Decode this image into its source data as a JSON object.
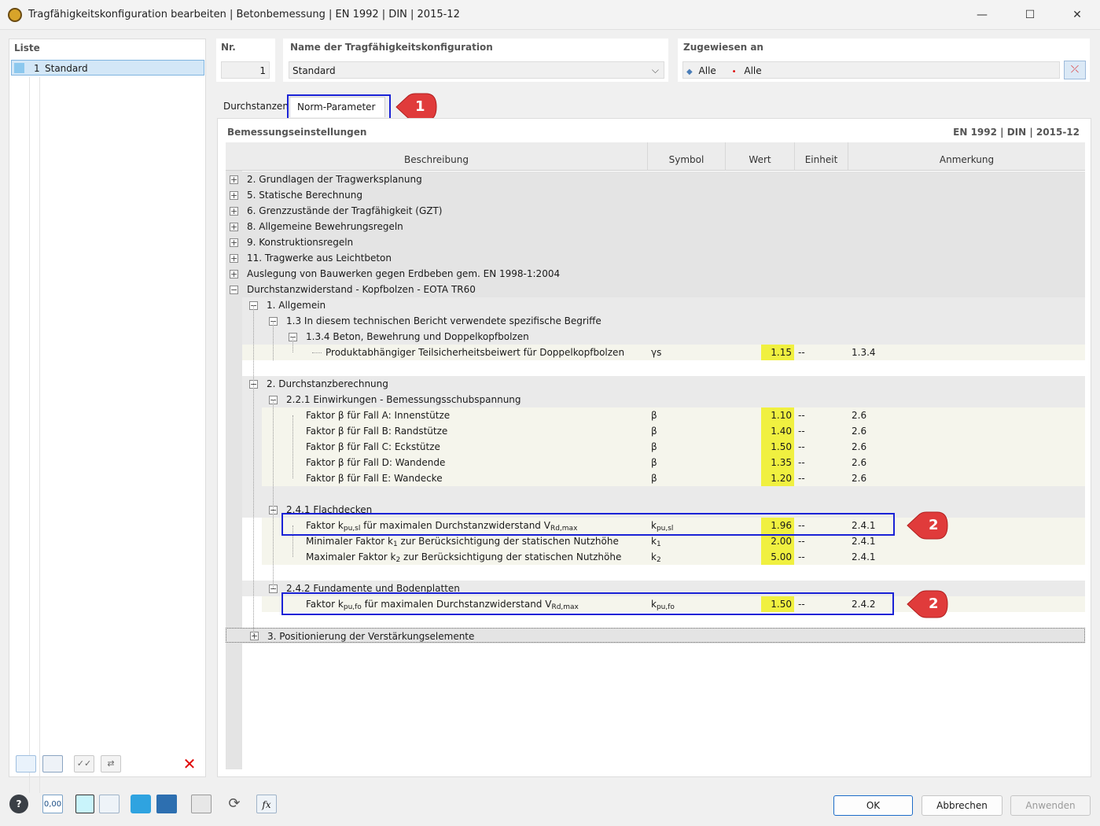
{
  "window": {
    "title": "Tragfähigkeitskonfiguration bearbeiten | Betonbemessung | EN 1992 | DIN | 2015-12",
    "minimize": "—",
    "maximize": "☐",
    "close": "✕"
  },
  "list": {
    "heading": "Liste",
    "items": [
      {
        "num": "1",
        "label": "Standard"
      }
    ]
  },
  "fields": {
    "nr_label": "Nr.",
    "nr_value": "1",
    "name_label": "Name der Tragfähigkeitskonfiguration",
    "name_value": "Standard",
    "assigned_label": "Zugewiesen an",
    "assigned_a": "Alle",
    "assigned_b": "Alle"
  },
  "tabs": [
    "Durchstanzen",
    "Norm-Parameter"
  ],
  "section": {
    "title": "Bemessungseinstellungen",
    "norm": "EN 1992 | DIN | 2015-12"
  },
  "columns": [
    "Beschreibung",
    "Symbol",
    "Wert",
    "Einheit",
    "Anmerkung"
  ],
  "rows": {
    "r1": "2. Grundlagen der Tragwerksplanung",
    "r2": "5. Statische Berechnung",
    "r3": "6. Grenzzustände der Tragfähigkeit (GZT)",
    "r4": "8. Allgemeine Bewehrungsregeln",
    "r5": "9. Konstruktionsregeln",
    "r6": "11. Tragwerke aus Leichtbeton",
    "r7": "Auslegung von Bauwerken gegen Erdbeben gem. EN 1998-1:2004",
    "r8": "Durchstanzwiderstand - Kopfbolzen - EOTA TR60",
    "r9": "1. Allgemein",
    "r10": "1.3 In diesem technischen Bericht verwendete spezifische Begriffe",
    "r11": "1.3.4 Beton, Bewehrung und Doppelkopfbolzen",
    "r12": "Produktabhängiger Teilsicherheitsbeiwert für Doppelkopfbolzen",
    "r12_sym": "γs",
    "r12_val": "1.15",
    "r12_unit": "--",
    "r12_note": "1.3.4",
    "r13": "2. Durchstanzberechnung",
    "r14": "2.2.1 Einwirkungen - Bemessungsschubspannung",
    "beta": [
      {
        "label": "Faktor β für Fall A: Innenstütze",
        "sym": "β",
        "val": "1.10",
        "unit": "--",
        "note": "2.6"
      },
      {
        "label": "Faktor β für Fall B: Randstütze",
        "sym": "β",
        "val": "1.40",
        "unit": "--",
        "note": "2.6"
      },
      {
        "label": "Faktor β für Fall C: Eckstütze",
        "sym": "β",
        "val": "1.50",
        "unit": "--",
        "note": "2.6"
      },
      {
        "label": "Faktor β für Fall D: Wandende",
        "sym": "β",
        "val": "1.35",
        "unit": "--",
        "note": "2.6"
      },
      {
        "label": "Faktor β für Fall E: Wandecke",
        "sym": "β",
        "val": "1.20",
        "unit": "--",
        "note": "2.6"
      }
    ],
    "r20": "2.4.1 Flachdecken",
    "r21_a": "Faktor k",
    "r21_sub": "pu,sl",
    "r21_b": " für maximalen Durchstanzwiderstand V",
    "r21_sub2": "Rd,max",
    "r21_sym": "k",
    "r21_symsub": "pu,sl",
    "r21_val": "1.96",
    "r21_unit": "--",
    "r21_note": "2.4.1",
    "r22_a": "Minimaler Faktor k",
    "r22_sub": "1",
    "r22_b": " zur Berücksichtigung der statischen Nutzhöhe",
    "r22_sym": "k",
    "r22_symsub": "1",
    "r22_val": "2.00",
    "r22_unit": "--",
    "r22_note": "2.4.1",
    "r23_a": "Maximaler Faktor k",
    "r23_sub": "2",
    "r23_b": " zur Berücksichtigung der statischen Nutzhöhe",
    "r23_sym": "k",
    "r23_symsub": "2",
    "r23_val": "5.00",
    "r23_unit": "--",
    "r23_note": "2.4.1",
    "r24": "2.4.2 Fundamente und Bodenplatten",
    "r25_a": "Faktor k",
    "r25_sub": "pu,fo",
    "r25_b": " für maximalen Durchstanzwiderstand V",
    "r25_sub2": "Rd,max",
    "r25_sym": "k",
    "r25_symsub": "pu,fo",
    "r25_val": "1.50",
    "r25_unit": "--",
    "r25_note": "2.4.2",
    "r26": "3. Positionierung der Verstärkungselemente"
  },
  "callouts": [
    "1",
    "2",
    "2"
  ],
  "buttons": {
    "ok": "OK",
    "cancel": "Abbrechen",
    "apply": "Anwenden"
  },
  "bottom_icons": {
    "units_label": "0,00"
  },
  "colors": {
    "value_highlight": "#f0f040",
    "callout_red": "#e03b3b",
    "highlight_box": "#1a22d6"
  }
}
